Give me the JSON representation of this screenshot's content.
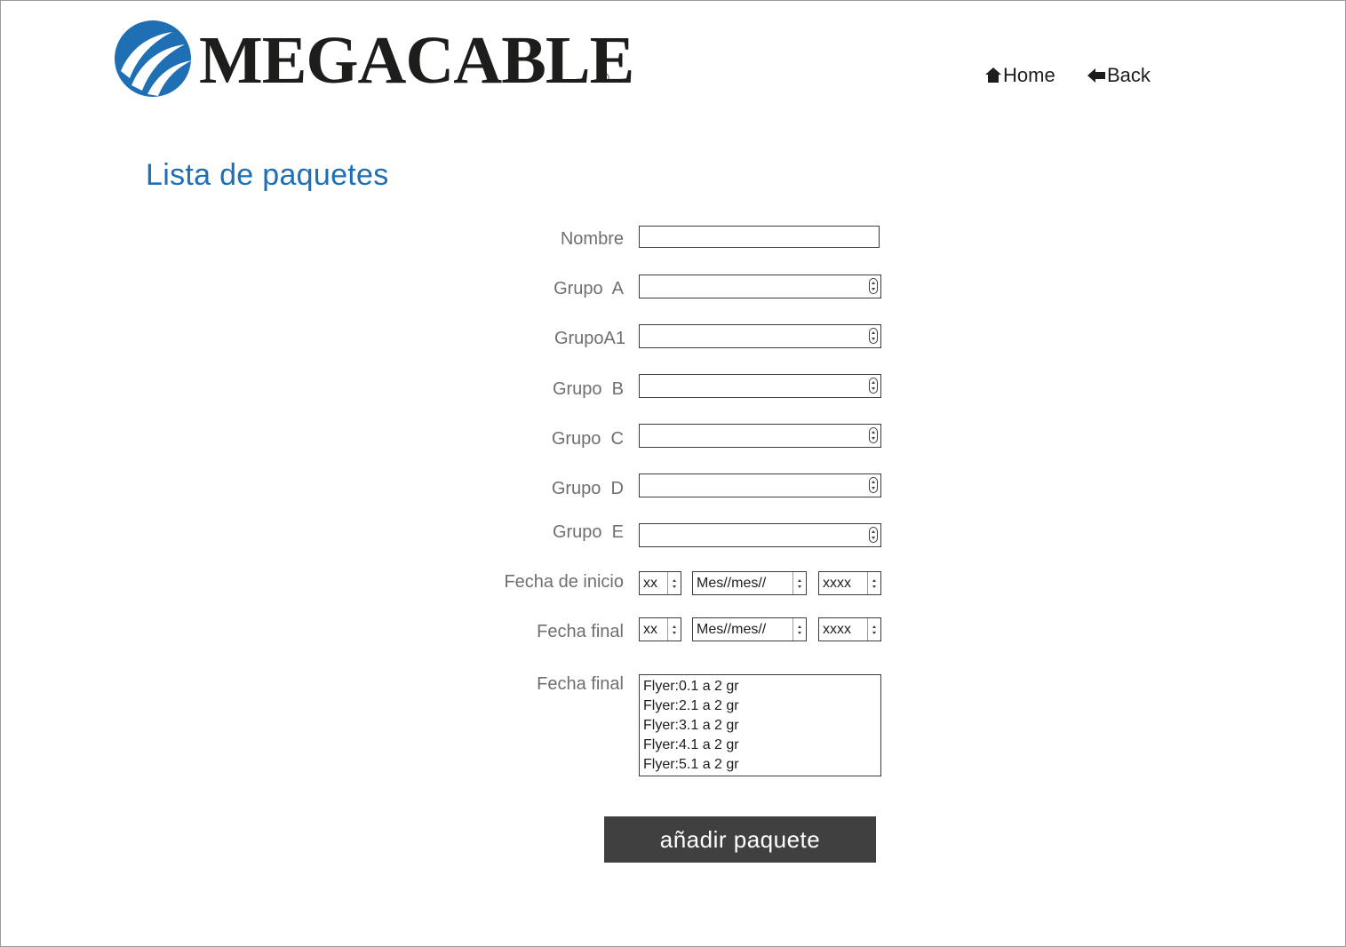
{
  "brand": {
    "name": "MEGACABLE",
    "registered_mark": "®",
    "logo_color": "#1e6fb4"
  },
  "nav": {
    "home_label": "Home",
    "home_icon": "house-icon",
    "back_label": "Back",
    "back_icon": "arrow-left-icon"
  },
  "page": {
    "title": "Lista de paquetes"
  },
  "form": {
    "nombre": {
      "label": "Nombre",
      "value": ""
    },
    "grupo_a": {
      "label": "Grupo  A",
      "value": ""
    },
    "grupo_a1": {
      "label": "GrupoA1",
      "value": ""
    },
    "grupo_b": {
      "label": "Grupo  B",
      "value": ""
    },
    "grupo_c": {
      "label": "Grupo  C",
      "value": ""
    },
    "grupo_d": {
      "label": "Grupo  D",
      "value": ""
    },
    "grupo_e": {
      "label": "Grupo  E",
      "value": ""
    },
    "fecha_inicio": {
      "label": "Fecha de inicio",
      "day": "xx",
      "month": "Mes//mes//",
      "year": "xxxx"
    },
    "fecha_final": {
      "label": "Fecha final",
      "day": "xx",
      "month": "Mes//mes//",
      "year": "xxxx"
    },
    "flyers": {
      "label": "Fecha final",
      "options": [
        "Flyer:0.1 a 2 gr",
        "Flyer:2.1 a 2 gr",
        "Flyer:3.1 a 2 gr",
        "Flyer:4.1 a 2 gr",
        "Flyer:5.1 a 2 gr"
      ]
    },
    "submit_label": "añadir paquete"
  },
  "colors": {
    "title": "#1e6fb4",
    "label": "#6f6f6f",
    "button_bg": "#404041",
    "button_text": "#ffffff"
  }
}
